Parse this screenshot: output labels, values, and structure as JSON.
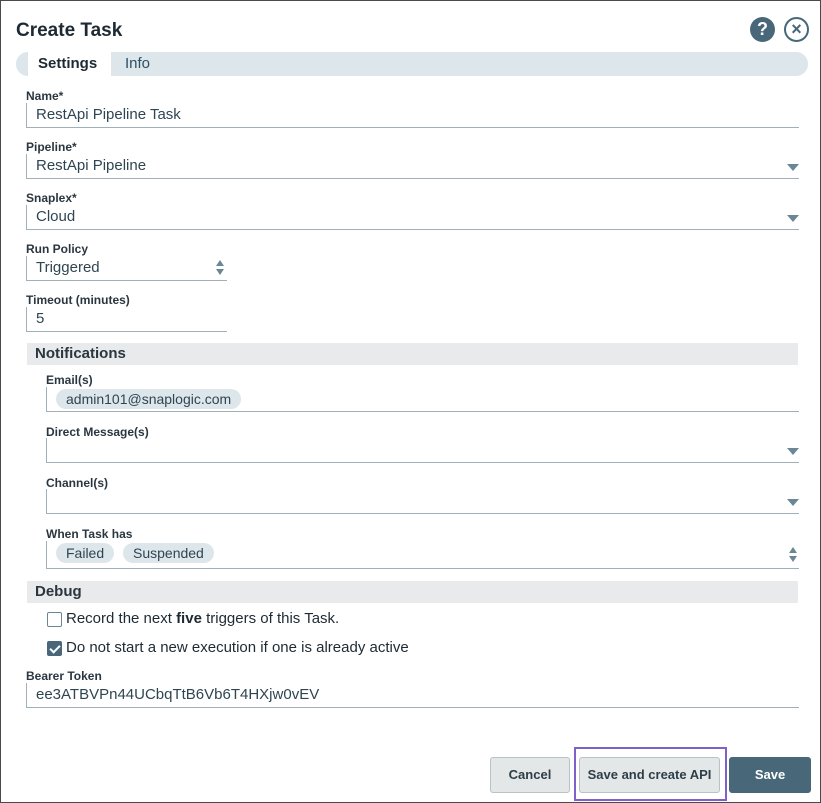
{
  "dialog": {
    "title": "Create Task",
    "help_label": "?",
    "close_label": "×"
  },
  "tabs": [
    {
      "label": "Settings",
      "active": true
    },
    {
      "label": "Info",
      "active": false
    }
  ],
  "fields": {
    "name": {
      "label": "Name*",
      "value": "RestApi Pipeline Task"
    },
    "pipeline": {
      "label": "Pipeline*",
      "value": "RestApi Pipeline"
    },
    "snaplex": {
      "label": "Snaplex*",
      "value": "Cloud"
    },
    "run_policy": {
      "label": "Run Policy",
      "value": "Triggered"
    },
    "timeout": {
      "label": "Timeout (minutes)",
      "value": "5"
    }
  },
  "notifications": {
    "title": "Notifications",
    "emails": {
      "label": "Email(s)",
      "chips": [
        "admin101@snaplogic.com"
      ]
    },
    "direct_messages": {
      "label": "Direct Message(s)",
      "value": ""
    },
    "channels": {
      "label": "Channel(s)",
      "value": ""
    },
    "when_task_has": {
      "label": "When Task has",
      "chips": [
        "Failed",
        "Suspended"
      ]
    }
  },
  "debug": {
    "title": "Debug",
    "record": {
      "prefix": "Record the next ",
      "bold": "five",
      "suffix": " triggers of this Task.",
      "checked": false
    },
    "no_new_execution": {
      "label": "Do not start a new execution if one is already active",
      "checked": true
    }
  },
  "bearer_token": {
    "label": "Bearer Token",
    "value": "ee3ATBVPn44UCbqTtB6Vb6T4HXjw0vEV"
  },
  "buttons": {
    "cancel": "Cancel",
    "save_and_create_api": "Save and create API",
    "save": "Save"
  },
  "colors": {
    "accent": "#48687a",
    "highlight_outline": "#7e62c9"
  }
}
